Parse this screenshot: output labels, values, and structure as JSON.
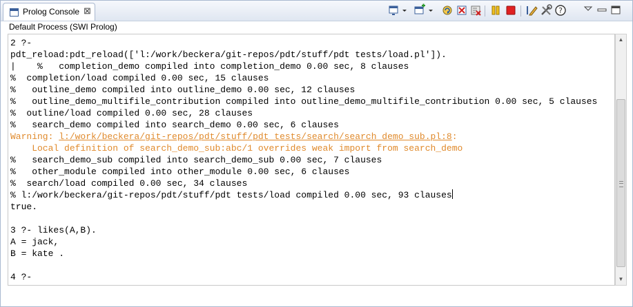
{
  "view": {
    "tab_label": "Prolog Console",
    "close_glyph": "⊠",
    "process_label": "Default Process (SWI Prolog)"
  },
  "toolbar": {
    "icons": [
      "console-display-icon",
      "dropdown-arrow-icon",
      "new-console-icon",
      "dropdown-arrow-icon",
      "reload-icon",
      "clear-console-icon",
      "remove-console-icon",
      "pause-icon",
      "stop-icon",
      "edit-icon",
      "tools-icon",
      "help-icon",
      "view-menu-icon",
      "minimize-icon",
      "maximize-icon"
    ]
  },
  "console": {
    "lines": [
      {
        "text": "2 ?-",
        "kind": "normal"
      },
      {
        "text": "pdt_reload:pdt_reload(['l:/work/beckera/git-repos/pdt/stuff/pdt tests/load.pl']).",
        "kind": "normal"
      },
      {
        "text": "|    %   completion_demo compiled into completion_demo 0.00 sec, 8 clauses",
        "kind": "normal"
      },
      {
        "text": "%  completion/load compiled 0.00 sec, 15 clauses",
        "kind": "normal"
      },
      {
        "text": "%   outline_demo compiled into outline_demo 0.00 sec, 12 clauses",
        "kind": "normal"
      },
      {
        "text": "%   outline_demo_multifile_contribution compiled into outline_demo_multifile_contribution 0.00 sec, 5 clauses",
        "kind": "normal"
      },
      {
        "text": "%  outline/load compiled 0.00 sec, 28 clauses",
        "kind": "normal"
      },
      {
        "text": "%   search_demo compiled into search_demo 0.00 sec, 6 clauses",
        "kind": "normal"
      },
      {
        "text": "Warning: ",
        "link": "l:/work/beckera/git-repos/pdt/stuff/pdt tests/search/search_demo_sub.pl:8",
        "after": ":",
        "kind": "warning"
      },
      {
        "text": "    Local definition of search_demo_sub:abc/1 overrides weak import from search_demo",
        "kind": "warning"
      },
      {
        "text": "%   search_demo_sub compiled into search_demo_sub 0.00 sec, 7 clauses",
        "kind": "normal"
      },
      {
        "text": "%   other_module compiled into other_module 0.00 sec, 6 clauses",
        "kind": "normal"
      },
      {
        "text": "%  search/load compiled 0.00 sec, 34 clauses",
        "kind": "normal"
      },
      {
        "text": "% l:/work/beckera/git-repos/pdt/stuff/pdt tests/load compiled 0.00 sec, 93 clauses",
        "kind": "normal",
        "cursor": true
      },
      {
        "text": "true.",
        "kind": "normal"
      },
      {
        "text": "",
        "kind": "normal"
      },
      {
        "text": "3 ?- likes(A,B).",
        "kind": "normal"
      },
      {
        "text": "A = jack,",
        "kind": "normal"
      },
      {
        "text": "B = kate .",
        "kind": "normal"
      },
      {
        "text": "",
        "kind": "normal"
      },
      {
        "text": "4 ?-",
        "kind": "normal"
      }
    ]
  },
  "colors": {
    "warning": "#e08a2c",
    "tab_border": "#a9b8d0"
  }
}
